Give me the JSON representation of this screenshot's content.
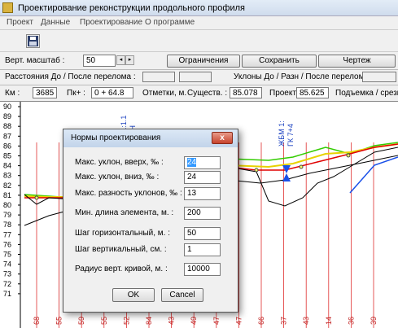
{
  "window": {
    "title": "Проектирование реконструкции продольного профиля"
  },
  "menu": [
    "Проект",
    "Данные",
    "Проектирование",
    "О программе"
  ],
  "toolbar": {
    "save_icon": "floppy-disk-icon"
  },
  "scale": {
    "label": "Верт. масштаб :",
    "value": "50",
    "buttons": [
      "Ограничения",
      "Сохранить",
      "Чертеж"
    ]
  },
  "distances": {
    "left_label": "Расстояния До / После перелома :",
    "right_label": "Уклоны До / Разн / После перелома :"
  },
  "status": {
    "km_label": "Км :",
    "km_value": "3685",
    "pk_label": "Пк+ :",
    "pk_value": "0 + 64.8",
    "marks_label": "Отметки, м.",
    "existing_label": "Существ. :",
    "existing_value": "85.078",
    "project_label": "Проект :",
    "project_value": "85.625",
    "lift_label": "Подъемка / срезк"
  },
  "chart": {
    "y_ticks": [
      "90",
      "89",
      "88",
      "87",
      "86",
      "85",
      "84",
      "83",
      "82",
      "81",
      "80",
      "79",
      "78",
      "77",
      "76",
      "75",
      "74",
      "73",
      "72",
      "71"
    ],
    "x_labels": [
      "68",
      "55",
      "59",
      "55",
      "52",
      "84",
      "43",
      "49",
      "47",
      "47",
      "66",
      "37",
      "43",
      "14",
      "36",
      "39"
    ],
    "vertical_labels": [
      "тв.1:1.1",
      "50 Н",
      "ЖБМ 1:",
      "ГК 7+4"
    ]
  },
  "dialog": {
    "title": "Нормы проектирования",
    "close_label": "x",
    "fields": [
      {
        "label": "Макс. уклон, вверх, ‰ :",
        "value": "24"
      },
      {
        "label": "Макс. уклон, вниз, ‰ :",
        "value": "24"
      },
      {
        "label": "Макс. разность уклонов, ‰ :",
        "value": "13"
      },
      {
        "label": "Мин. длина элемента, м. :",
        "value": "200"
      },
      {
        "label": "Шаг горизонтальный, м. :",
        "value": "50"
      },
      {
        "label": "Шаг вертикальный, см. :",
        "value": "1"
      },
      {
        "label": "Радиус  верт. кривой, м. :",
        "value": "10000"
      }
    ],
    "ok_label": "OK",
    "cancel_label": "Cancel"
  }
}
